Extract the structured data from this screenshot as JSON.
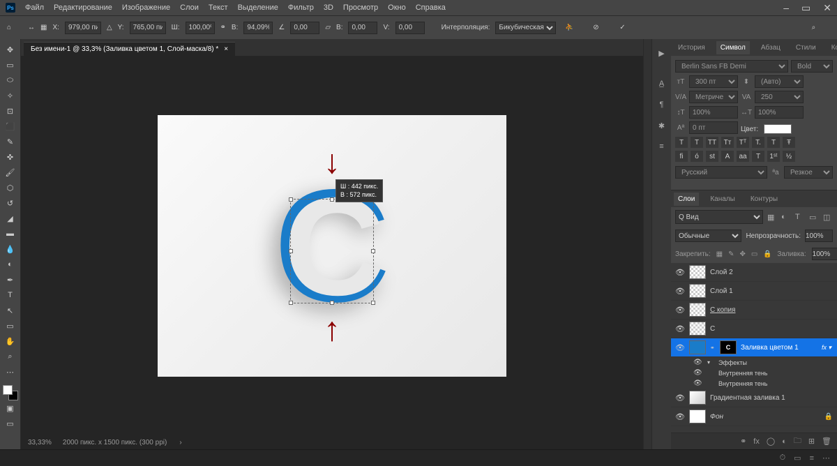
{
  "app_logo": "Ps",
  "menu": [
    "Файл",
    "Редактирование",
    "Изображение",
    "Слои",
    "Текст",
    "Выделение",
    "Фильтр",
    "3D",
    "Просмотр",
    "Окно",
    "Справка"
  ],
  "window_controls": [
    "–",
    "▭",
    "✕"
  ],
  "options": {
    "x_label": "X:",
    "x": "979,00 пи",
    "y_label": "Y:",
    "y": "765,00 пи",
    "w_label": "Ш:",
    "w": "100,00%",
    "h_label": "В:",
    "h": "94,09%",
    "angle_label": "∠",
    "angle": "0,00",
    "skewh_label": "В:",
    "skewh": "0,00",
    "skewv_label": "V:",
    "skewv": "0,00",
    "interp_label": "Интерполяция:",
    "interp": "Бикубическая"
  },
  "doc_tab": "Без имени-1 @ 33,3% (Заливка цветом 1, Слой-маска/8) *",
  "canvas_letter": "C",
  "tooltip_w": "Ш :  442 пикс.",
  "tooltip_h": "В :  572 пикс.",
  "status": {
    "zoom": "33,33%",
    "info": "2000 пикс. x 1500 пикс. (300 ppi)"
  },
  "top_panel_tabs": [
    "История",
    "Символ",
    "Абзац",
    "Стили",
    "Коррекция"
  ],
  "char": {
    "font": "Berlin Sans FB Demi",
    "style": "Bold",
    "size": "300 пт",
    "leading": "(Авто)",
    "kerning": "Метрически",
    "tracking": "250",
    "vscale": "100%",
    "hscale": "100%",
    "baseline": "0 пт",
    "color_label": "Цвет:",
    "lang": "Русский",
    "aa": "Резкое"
  },
  "text_format_btns": [
    "T",
    "T",
    "TT",
    "Tт",
    "Tᵀ",
    "T.",
    "T",
    "Ŧ"
  ],
  "opentype_btns": [
    "fi",
    "ó",
    "st",
    "A",
    "aa",
    "T",
    "1ˢᵗ",
    "½"
  ],
  "layers_panel_tabs": [
    "Слои",
    "Каналы",
    "Контуры"
  ],
  "layers": {
    "filter": "Q Вид",
    "blend": "Обычные",
    "opacity_label": "Непрозрачность:",
    "opacity": "100%",
    "lock_label": "Закрепить:",
    "fill_label": "Заливка:",
    "fill": "100%",
    "items": [
      {
        "name": "Слой 2"
      },
      {
        "name": "Слой 1"
      },
      {
        "name": "С копия"
      },
      {
        "name": "С"
      },
      {
        "name": "Заливка цветом 1"
      },
      {
        "name": "Эффекты"
      },
      {
        "name": "Внутренняя тень"
      },
      {
        "name": "Внутренняя тень"
      },
      {
        "name": "Градиентная заливка 1"
      },
      {
        "name": "Фон"
      }
    ]
  }
}
